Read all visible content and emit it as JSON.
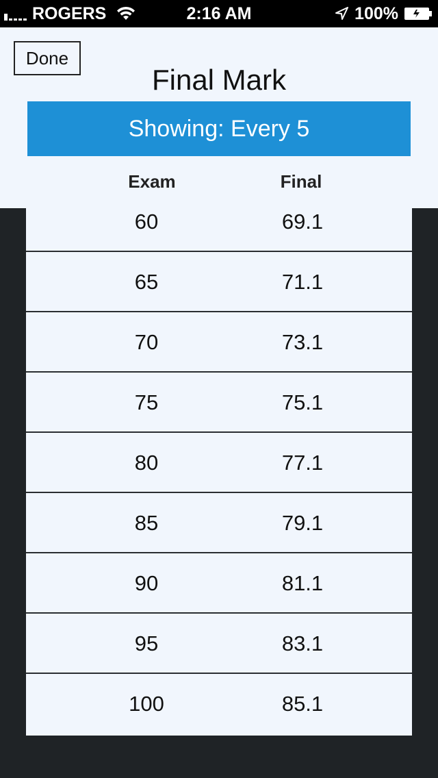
{
  "status_bar": {
    "carrier": "ROGERS",
    "time": "2:16 AM",
    "battery": "100%"
  },
  "header": {
    "done_label": "Done",
    "title": "Final Mark",
    "showing_label": "Showing: Every 5"
  },
  "table": {
    "columns": [
      "Exam",
      "Final"
    ],
    "rows": [
      {
        "exam": "60",
        "final": "69.1"
      },
      {
        "exam": "65",
        "final": "71.1"
      },
      {
        "exam": "70",
        "final": "73.1"
      },
      {
        "exam": "75",
        "final": "75.1"
      },
      {
        "exam": "80",
        "final": "77.1"
      },
      {
        "exam": "85",
        "final": "79.1"
      },
      {
        "exam": "90",
        "final": "81.1"
      },
      {
        "exam": "95",
        "final": "83.1"
      },
      {
        "exam": "100",
        "final": "85.1"
      }
    ]
  },
  "colors": {
    "accent": "#1e90d6",
    "panel": "#f1f6fd",
    "background": "#1f2326"
  },
  "icons": [
    "signal-icon",
    "wifi-icon",
    "location-arrow-icon",
    "battery-icon"
  ]
}
